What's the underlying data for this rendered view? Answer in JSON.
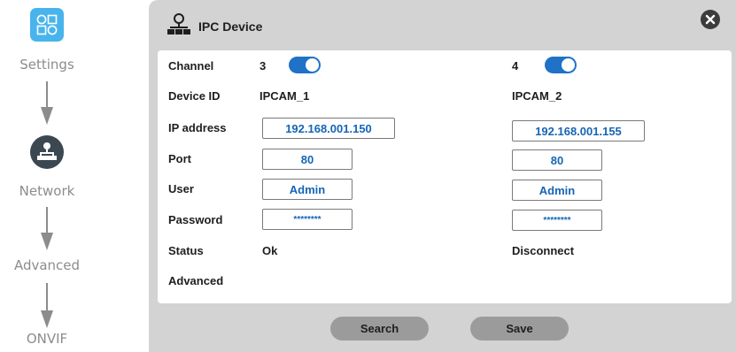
{
  "sidebar": {
    "steps": [
      {
        "label": "Settings",
        "icon": "settings-grid-icon"
      },
      {
        "label": "Network",
        "icon": "network-icon"
      },
      {
        "label": "Advanced"
      },
      {
        "label": "ONVIF"
      }
    ]
  },
  "dialog": {
    "title": "IPC Device",
    "header_icon": "network-device-icon",
    "close_icon": "close-icon",
    "labels": {
      "channel": "Channel",
      "device_id": "Device ID",
      "ip_address": "IP address",
      "port": "Port",
      "user": "User",
      "password": "Password",
      "status": "Status",
      "advanced": "Advanced"
    },
    "channels": [
      {
        "number": "3",
        "enabled": true,
        "device_id": "IPCAM_1",
        "ip": "192.168.001.150",
        "port": "80",
        "user": "Admin",
        "password": "********",
        "status": "Ok"
      },
      {
        "number": "4",
        "enabled": true,
        "device_id": "IPCAM_2",
        "ip": "192.168.001.155",
        "port": "80",
        "user": "Admin",
        "password": "********",
        "status": "Disconnect"
      }
    ],
    "buttons": {
      "search": "Search",
      "save": "Save"
    }
  },
  "colors": {
    "accent": "#1f72c6",
    "settings_icon_bg": "#49b4ec",
    "network_icon_bg": "#3b4852",
    "dialog_bg": "#d3d3d3",
    "field_text": "#1565b5",
    "button_bg": "#9b9b9b"
  }
}
